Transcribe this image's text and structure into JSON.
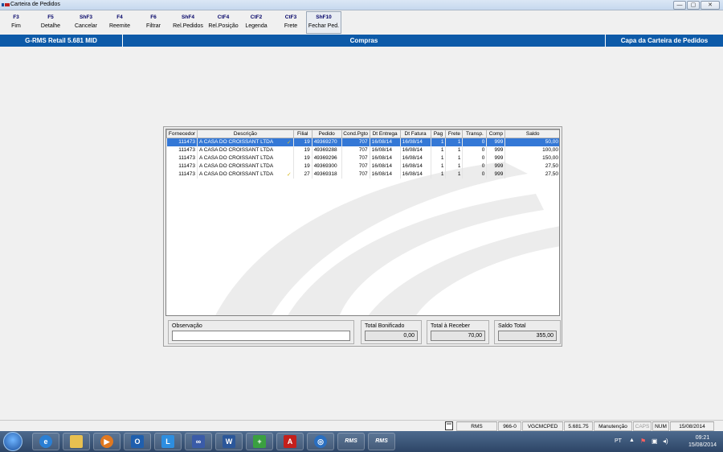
{
  "window": {
    "title": "Carteira de Pedidos",
    "minimize": "—",
    "maximize": "▢",
    "close": "✕"
  },
  "toolbar": [
    {
      "key": "F3",
      "label": "Fim"
    },
    {
      "key": "F5",
      "label": "Detalhe"
    },
    {
      "key": "ShF3",
      "label": "Cancelar"
    },
    {
      "key": "F4",
      "label": "Reemite"
    },
    {
      "key": "F6",
      "label": "Filtrar"
    },
    {
      "key": "ShF4",
      "label": "Rel.Pedidos"
    },
    {
      "key": "CtF4",
      "label": "Rel.Posição"
    },
    {
      "key": "CtF2",
      "label": "Legenda"
    },
    {
      "key": "CtF3",
      "label": "Frete"
    },
    {
      "key": "ShF10",
      "label": "Fechar Ped."
    }
  ],
  "header": {
    "system": "G-RMS Retail 5.681 MID",
    "module": "Compras",
    "screen": "Capa da Carteira de Pedidos"
  },
  "table": {
    "columns": [
      "Fornecedor",
      "Descrição",
      "Filial",
      "Pedido",
      "Cond.Pgto",
      "Dt Entrega",
      "Dt Fatura",
      "Pag",
      "Frete",
      "Transp.",
      "Comp",
      "Saldo"
    ],
    "rows": [
      {
        "fornecedor": "111473",
        "descricao": "A CASA DO CROISSANT LTDA",
        "check": "✓",
        "filial": "19",
        "pedido": "49369270",
        "cond": "707",
        "entrega": "16/08/14",
        "fatura": "16/08/14",
        "pag": "1",
        "frete": "1",
        "transp": "0",
        "comp": "999",
        "saldo": "50,00"
      },
      {
        "fornecedor": "111473",
        "descricao": "A CASA DO CROISSANT LTDA",
        "check": "",
        "filial": "19",
        "pedido": "49369288",
        "cond": "707",
        "entrega": "16/08/14",
        "fatura": "16/08/14",
        "pag": "1",
        "frete": "1",
        "transp": "0",
        "comp": "999",
        "saldo": "100,00"
      },
      {
        "fornecedor": "111473",
        "descricao": "A CASA DO CROISSANT LTDA",
        "check": "",
        "filial": "19",
        "pedido": "49369296",
        "cond": "707",
        "entrega": "16/08/14",
        "fatura": "16/08/14",
        "pag": "1",
        "frete": "1",
        "transp": "0",
        "comp": "999",
        "saldo": "150,00"
      },
      {
        "fornecedor": "111473",
        "descricao": "A CASA DO CROISSANT LTDA",
        "check": "",
        "filial": "19",
        "pedido": "49369300",
        "cond": "707",
        "entrega": "16/08/14",
        "fatura": "16/08/14",
        "pag": "1",
        "frete": "1",
        "transp": "0",
        "comp": "999",
        "saldo": "27,50"
      },
      {
        "fornecedor": "111473",
        "descricao": "A CASA DO CROISSANT LTDA",
        "check": "✓",
        "filial": "27",
        "pedido": "49369318",
        "cond": "707",
        "entrega": "16/08/14",
        "fatura": "16/08/14",
        "pag": "1",
        "frete": "1",
        "transp": "0",
        "comp": "999",
        "saldo": "27,50"
      }
    ],
    "selected_row": 0
  },
  "footer": {
    "observacao_label": "Observação",
    "observacao_value": "",
    "total_bonificado_label": "Total Bonificado",
    "total_bonificado": "0,00",
    "total_receber_label": "Total à Receber",
    "total_receber": "70,00",
    "saldo_total_label": "Saldo Total",
    "saldo_total": "355,00"
  },
  "statusbar": {
    "system": "RMS",
    "code": "966-0",
    "program": "VGCMCPED",
    "version": "5.681.75",
    "mode": "Manutenção",
    "caps": "CAPS",
    "num": "NUM",
    "date": "15/08/2014"
  },
  "taskbar": {
    "apps": [
      "ie-icon",
      "explorer-icon",
      "media-player-icon",
      "outlook-icon",
      "lync-icon",
      "infinity-icon",
      "word-icon",
      "medical-app-icon",
      "pdf-icon",
      "network-icon",
      "rms-icon",
      "rms-icon"
    ],
    "rms_label": "RMS",
    "lang": "PT",
    "time": "09:21",
    "date": "15/08/2014"
  },
  "colors": {
    "accent": "#0d5aa8",
    "selection": "#3478d6",
    "check": "#d6b81f"
  }
}
